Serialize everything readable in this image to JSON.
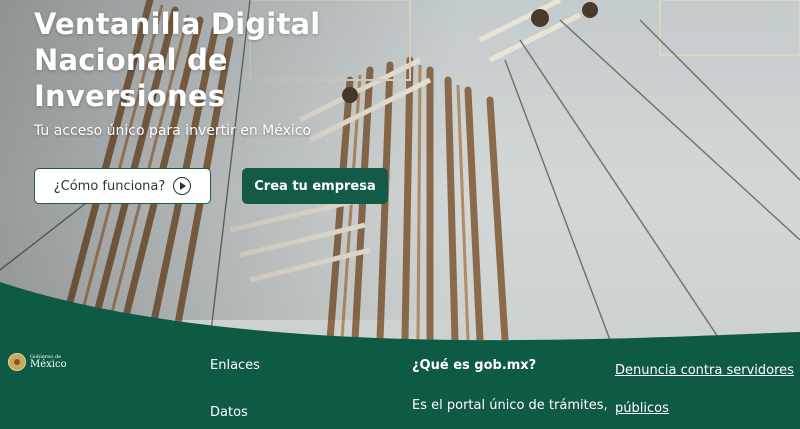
{
  "hero": {
    "title_line1": "Ventanilla Digital",
    "title_line2": "Nacional de",
    "title_line3": "Inversiones",
    "subtitle": "Tu acceso único para invertir en México",
    "how_button_label": "¿Cómo funciona?",
    "create_button_label": "Crea tu empresa"
  },
  "footer": {
    "logo_small": "Gobierno de",
    "logo_big": "México",
    "links": [
      "Enlaces",
      "Datos"
    ],
    "about_title": "¿Qué es gob.mx?",
    "about_text": "Es el portal único de trámites,",
    "report_link_line1": "Denuncia contra servidores",
    "report_link_line2": "públicos"
  },
  "colors": {
    "brand_green": "#135a47",
    "footer_green": "#0f5a44"
  },
  "icons": {
    "play": "play-circle-icon",
    "seal": "mexico-seal-icon"
  }
}
